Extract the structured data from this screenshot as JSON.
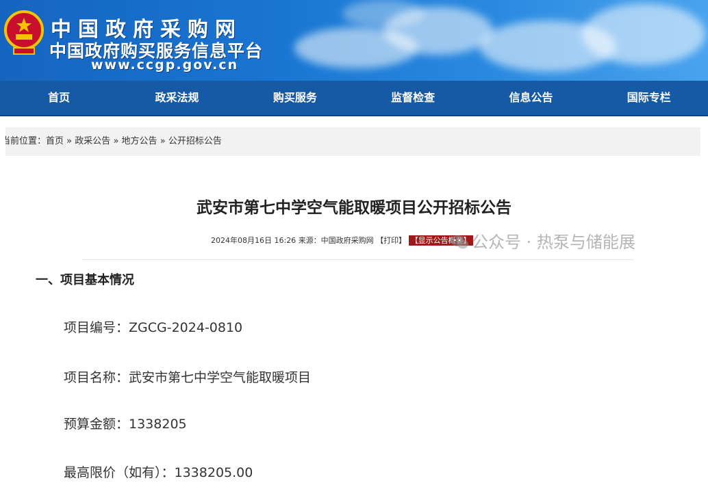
{
  "header": {
    "site_name": "中国政府采购网",
    "site_subtitle": "中国政府购买服务信息平台",
    "site_url": "www.ccgp.gov.cn"
  },
  "nav": {
    "items": [
      "首页",
      "政采法规",
      "购买服务",
      "监督检查",
      "信息公告",
      "国际专栏"
    ]
  },
  "breadcrumb": {
    "label": "当前位置：",
    "items": [
      "首页",
      "政采公告",
      "地方公告",
      "公开招标公告"
    ],
    "separator": "»"
  },
  "article": {
    "title": "武安市第七中学空气能取暖项目公开招标公告",
    "meta": {
      "datetime": "2024年08月16日 16:26",
      "source": "来源：中国政府采购网",
      "print_label": "【打印】",
      "summary_label": "【显示公告概要】"
    },
    "section_title": "一、项目基本情况",
    "fields": [
      "项目编号：ZGCG-2024-0810",
      "项目名称：武安市第七中学空气能取暖项目",
      "预算金额：1338205",
      "最高限价（如有）：1338205.00"
    ]
  },
  "watermark": {
    "text": "公众号 · 热泵与储能展",
    "icon": "wechat-icon"
  },
  "colors": {
    "nav_bg": "#165aa6",
    "banner_blue": "#1976d2",
    "tag_red": "#a01818"
  }
}
